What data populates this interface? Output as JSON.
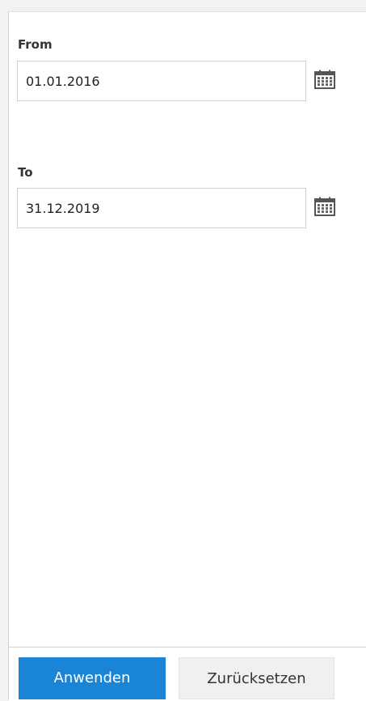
{
  "filter": {
    "from": {
      "label": "From",
      "value": "01.01.2016",
      "calendar_icon": "calendar-icon"
    },
    "to": {
      "label": "To",
      "value": "31.12.2019",
      "calendar_icon": "calendar-icon"
    }
  },
  "actions": {
    "apply_label": "Anwenden",
    "reset_label": "Zurücksetzen"
  },
  "colors": {
    "primary": "#1a85d7",
    "secondary_bg": "#f0f0f0"
  }
}
